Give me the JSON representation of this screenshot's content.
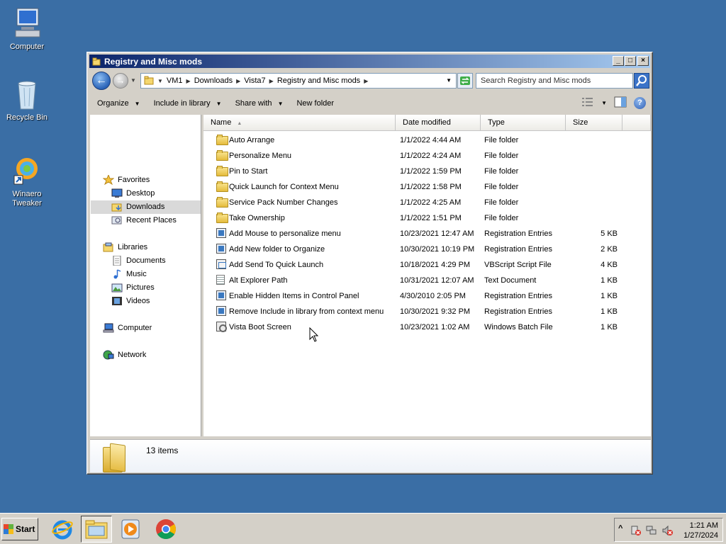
{
  "desktop": {
    "icons": [
      {
        "label": "Computer"
      },
      {
        "label": "Recycle Bin"
      },
      {
        "label": "Winaero Tweaker"
      }
    ]
  },
  "window": {
    "title": "Registry and Misc mods",
    "controls": {
      "minimize": "_",
      "maximize": "□",
      "close": "×"
    }
  },
  "address": {
    "crumbs": [
      "VM1",
      "Downloads",
      "Vista7",
      "Registry and Misc mods"
    ],
    "search_placeholder": "Search Registry and Misc mods"
  },
  "toolbar": {
    "organize": "Organize",
    "include_in_library": "Include in library",
    "share_with": "Share with",
    "new_folder": "New folder"
  },
  "nav": {
    "favorites": "Favorites",
    "desktop": "Desktop",
    "downloads": "Downloads",
    "recent_places": "Recent Places",
    "libraries": "Libraries",
    "documents": "Documents",
    "music": "Music",
    "pictures": "Pictures",
    "videos": "Videos",
    "computer": "Computer",
    "network": "Network"
  },
  "columns": {
    "name": "Name",
    "date": "Date modified",
    "type": "Type",
    "size": "Size"
  },
  "files": [
    {
      "name": "Auto Arrange",
      "date": "1/1/2022 4:44 AM",
      "type": "File folder",
      "size": "",
      "icon": "folder"
    },
    {
      "name": "Personalize Menu",
      "date": "1/1/2022 4:24 AM",
      "type": "File folder",
      "size": "",
      "icon": "folder"
    },
    {
      "name": "Pin to Start",
      "date": "1/1/2022 1:59 PM",
      "type": "File folder",
      "size": "",
      "icon": "folder"
    },
    {
      "name": "Quick Launch for Context Menu",
      "date": "1/1/2022 1:58 PM",
      "type": "File folder",
      "size": "",
      "icon": "folder"
    },
    {
      "name": "Service Pack Number Changes",
      "date": "1/1/2022 4:25 AM",
      "type": "File folder",
      "size": "",
      "icon": "folder"
    },
    {
      "name": "Take Ownership",
      "date": "1/1/2022 1:51 PM",
      "type": "File folder",
      "size": "",
      "icon": "folder"
    },
    {
      "name": "Add Mouse to personalize menu",
      "date": "10/23/2021 12:47 AM",
      "type": "Registration Entries",
      "size": "5 KB",
      "icon": "reg"
    },
    {
      "name": "Add New folder to Organize",
      "date": "10/30/2021 10:19 PM",
      "type": "Registration Entries",
      "size": "2 KB",
      "icon": "reg"
    },
    {
      "name": "Add Send To Quick Launch",
      "date": "10/18/2021 4:29 PM",
      "type": "VBScript Script File",
      "size": "4 KB",
      "icon": "vbs"
    },
    {
      "name": "Alt Explorer Path",
      "date": "10/31/2021 12:07 AM",
      "type": "Text Document",
      "size": "1 KB",
      "icon": "txt"
    },
    {
      "name": "Enable Hidden Items in Control Panel",
      "date": "4/30/2010 2:05 PM",
      "type": "Registration Entries",
      "size": "1 KB",
      "icon": "reg"
    },
    {
      "name": "Remove Include in library from context menu",
      "date": "10/30/2021 9:32 PM",
      "type": "Registration Entries",
      "size": "1 KB",
      "icon": "reg"
    },
    {
      "name": "Vista Boot Screen",
      "date": "10/23/2021 1:02 AM",
      "type": "Windows Batch File",
      "size": "1 KB",
      "icon": "bat"
    }
  ],
  "details": {
    "count": "13 items"
  },
  "taskbar": {
    "start": "Start",
    "time": "1:21 AM",
    "date": "1/27/2024",
    "tray_expand": "^"
  }
}
